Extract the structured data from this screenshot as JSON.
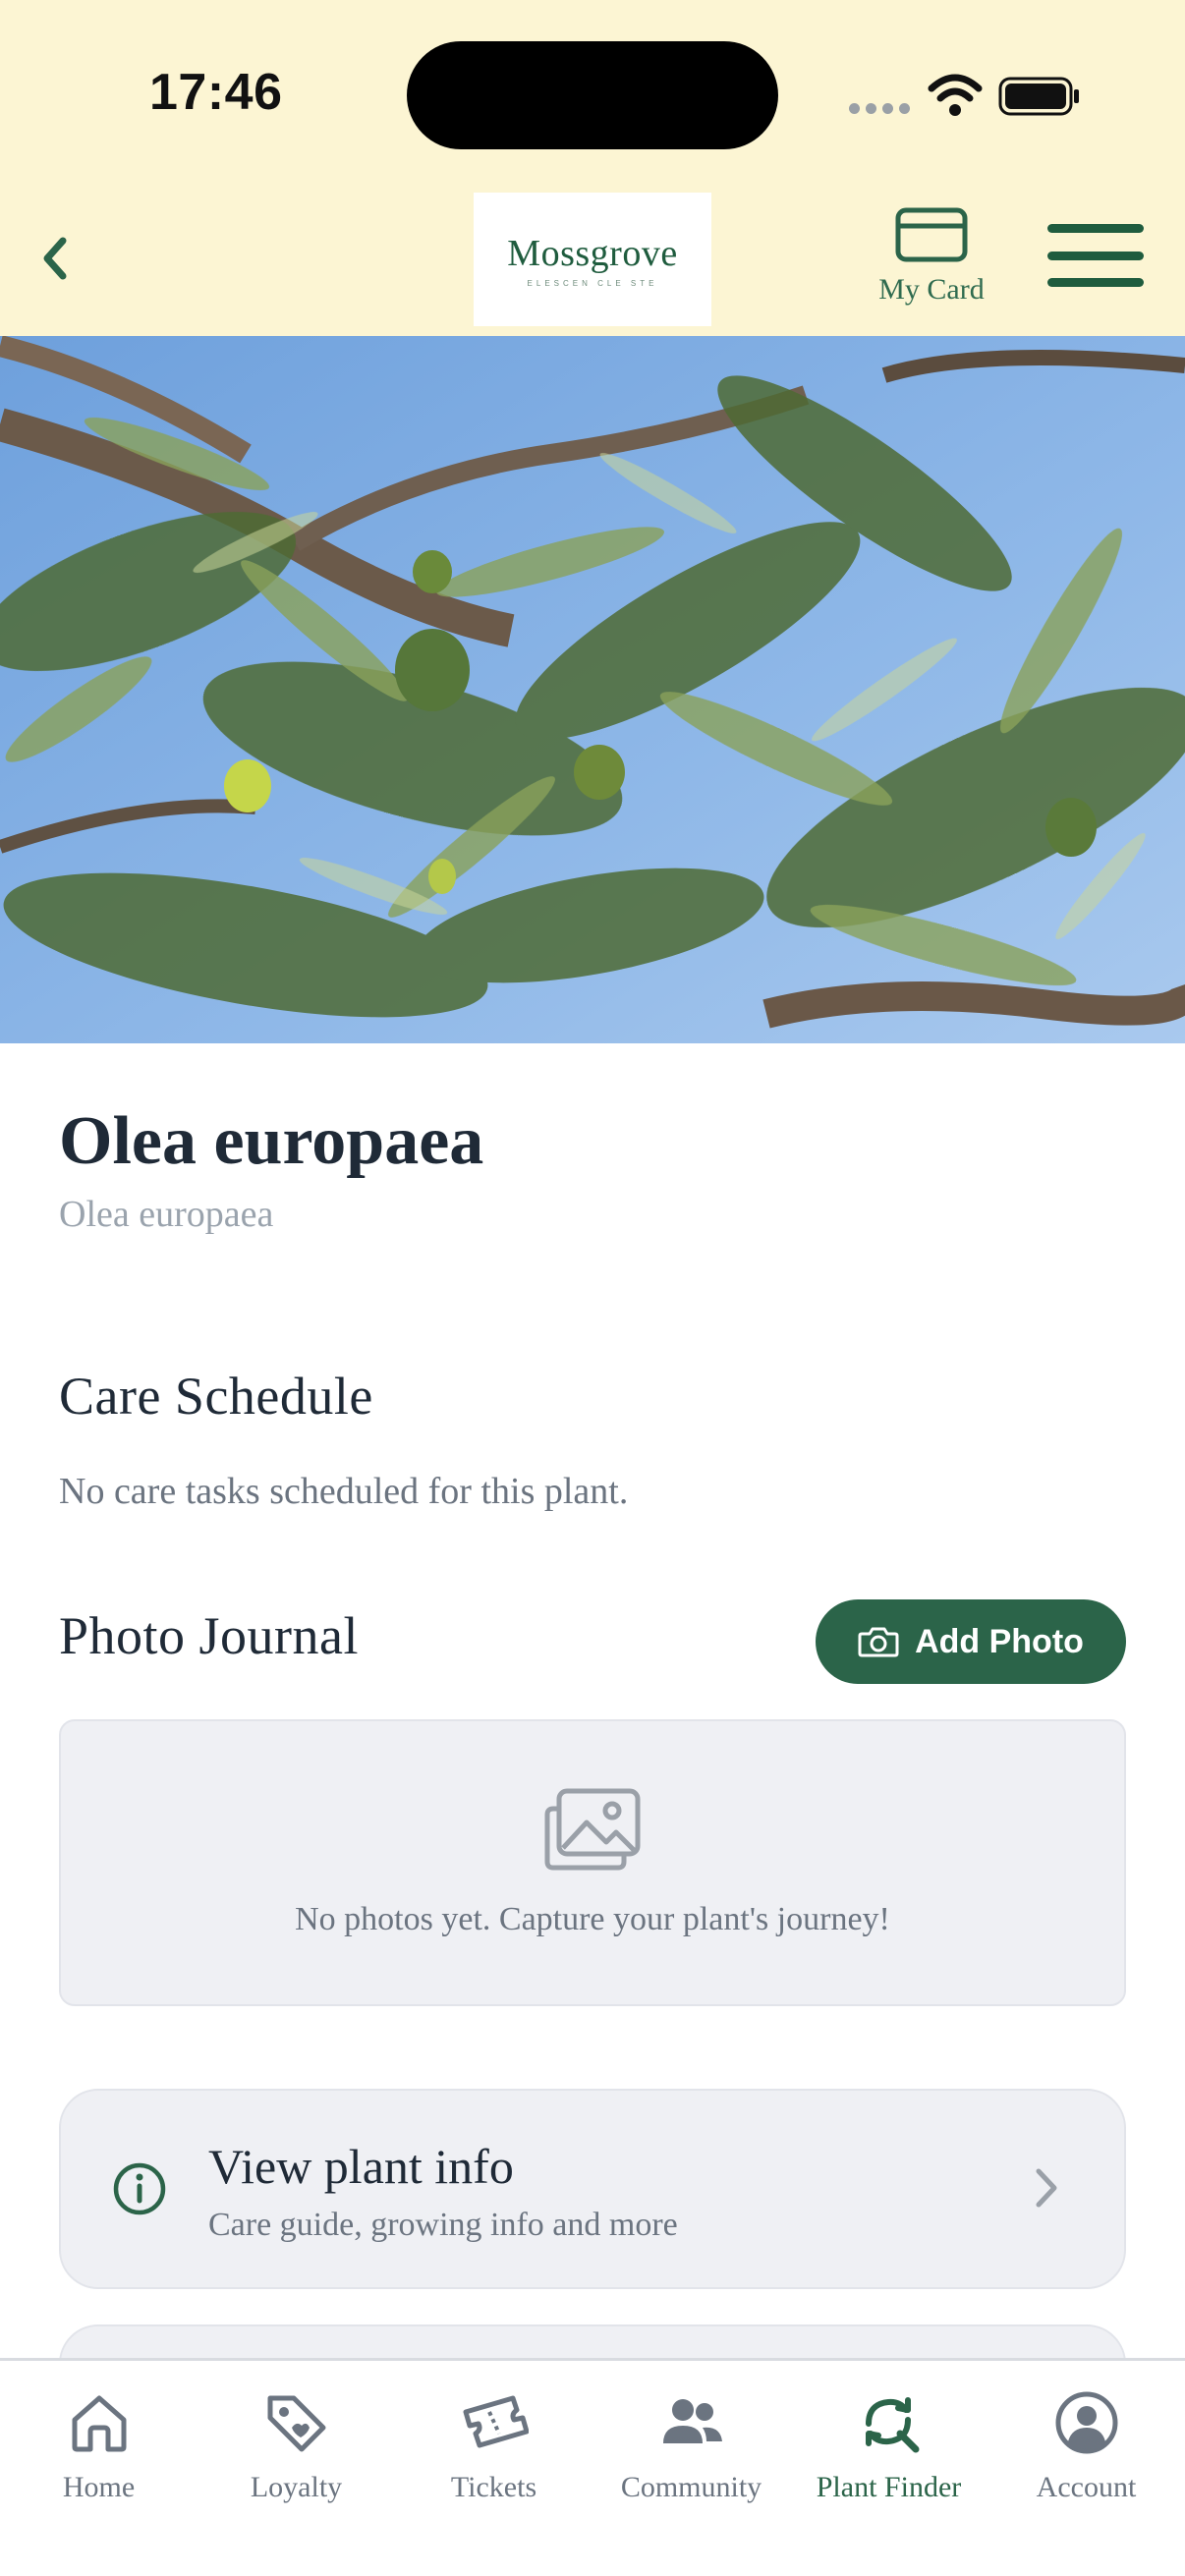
{
  "status_bar": {
    "time": "17:46"
  },
  "header": {
    "logo_text": "Mossgrove",
    "logo_tagline": "ELESCEN CLE STE",
    "my_card_label": "My Card"
  },
  "plant": {
    "title": "Olea europaea",
    "subtitle": "Olea europaea"
  },
  "care_schedule": {
    "heading": "Care Schedule",
    "empty_text": "No care tasks scheduled for this plant."
  },
  "photo_journal": {
    "heading": "Photo Journal",
    "add_photo_label": "Add Photo",
    "empty_text": "No photos yet. Capture your plant's journey!"
  },
  "info_row": {
    "title": "View plant info",
    "subtitle": "Care guide, growing info and more"
  },
  "tabs": [
    {
      "label": "Home",
      "icon": "home-icon"
    },
    {
      "label": "Loyalty",
      "icon": "tag-icon"
    },
    {
      "label": "Tickets",
      "icon": "ticket-icon"
    },
    {
      "label": "Community",
      "icon": "people-icon"
    },
    {
      "label": "Plant Finder",
      "icon": "plant-search-icon",
      "active": true
    },
    {
      "label": "Account",
      "icon": "user-circle-icon"
    }
  ],
  "colors": {
    "header_bg": "#fcf5d3",
    "brand_green": "#2b6449",
    "card_bg": "#eff0f4"
  }
}
